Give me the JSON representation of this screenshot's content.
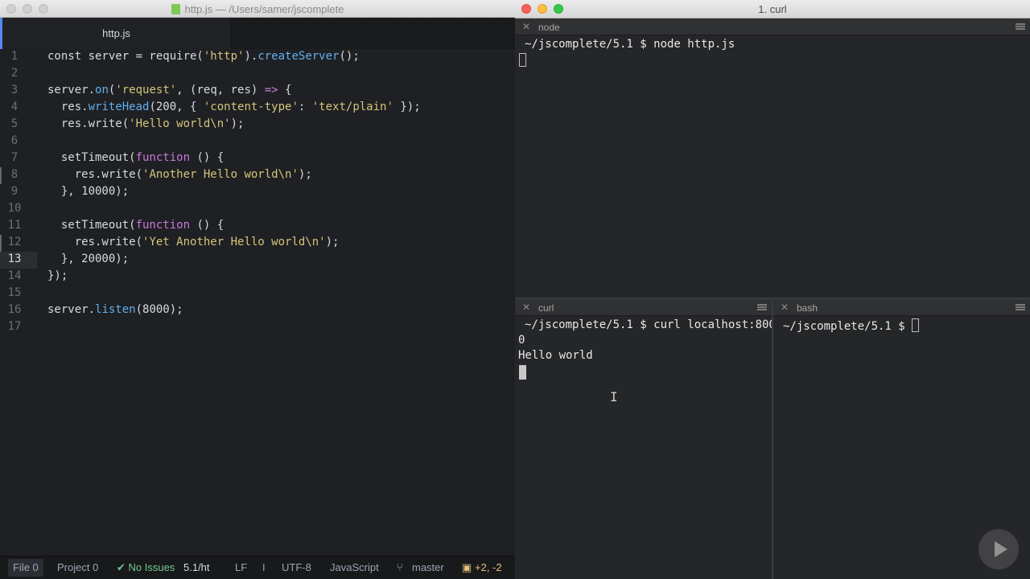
{
  "editor": {
    "window_title": "http.js — /Users/samer/jscomplete",
    "tab_label": "http.js",
    "active_line": 13,
    "lines": [
      {
        "num": "1",
        "tokens": [
          [
            "n",
            "const server = require("
          ],
          [
            "s",
            "'http'"
          ],
          [
            "n",
            ")."
          ],
          [
            "f",
            "createServer"
          ],
          [
            "n",
            "();"
          ]
        ]
      },
      {
        "num": "2",
        "tokens": []
      },
      {
        "num": "3",
        "tokens": [
          [
            "n",
            "server."
          ],
          [
            "f",
            "on"
          ],
          [
            "n",
            "("
          ],
          [
            "s",
            "'request'"
          ],
          [
            "n",
            ", (req, res) "
          ],
          [
            "k",
            "=>"
          ],
          [
            "n",
            " {"
          ]
        ]
      },
      {
        "num": "4",
        "tokens": [
          [
            "n",
            "  res."
          ],
          [
            "f",
            "writeHead"
          ],
          [
            "n",
            "(200, { "
          ],
          [
            "s",
            "'content-type'"
          ],
          [
            "n",
            ": "
          ],
          [
            "s",
            "'text/plain'"
          ],
          [
            "n",
            " });"
          ]
        ]
      },
      {
        "num": "5",
        "tokens": [
          [
            "n",
            "  res.write("
          ],
          [
            "s",
            "'Hello world\\n'"
          ],
          [
            "n",
            ");"
          ]
        ]
      },
      {
        "num": "6",
        "tokens": []
      },
      {
        "num": "7",
        "tokens": [
          [
            "n",
            "  setTimeout("
          ],
          [
            "k",
            "function"
          ],
          [
            "n",
            " () {"
          ]
        ]
      },
      {
        "num": "8",
        "tokens": [
          [
            "n",
            "    res.write("
          ],
          [
            "s",
            "'Another Hello world\\n'"
          ],
          [
            "n",
            ");"
          ]
        ]
      },
      {
        "num": "9",
        "tokens": [
          [
            "n",
            "  }, 10000);"
          ]
        ]
      },
      {
        "num": "10",
        "tokens": []
      },
      {
        "num": "11",
        "tokens": [
          [
            "n",
            "  setTimeout("
          ],
          [
            "k",
            "function"
          ],
          [
            "n",
            " () {"
          ]
        ]
      },
      {
        "num": "12",
        "tokens": [
          [
            "n",
            "    res.write("
          ],
          [
            "s",
            "'Yet Another Hello world\\n'"
          ],
          [
            "n",
            ");"
          ]
        ]
      },
      {
        "num": "13",
        "tokens": [
          [
            "n",
            "  }, 20000);"
          ]
        ]
      },
      {
        "num": "14",
        "tokens": [
          [
            "n",
            "});"
          ]
        ]
      },
      {
        "num": "15",
        "tokens": []
      },
      {
        "num": "16",
        "tokens": [
          [
            "n",
            "server."
          ],
          [
            "f",
            "listen"
          ],
          [
            "n",
            "(8000);"
          ]
        ]
      },
      {
        "num": "17",
        "tokens": []
      }
    ],
    "modified_lines": [
      8,
      12
    ],
    "status": {
      "file": "File 0",
      "project": "Project 0",
      "issues": "✔ No Issues",
      "path": "5.1/ht",
      "line_ending": "LF",
      "cursor_glyph": "I",
      "encoding": "UTF-8",
      "grammar": "JavaScript",
      "branch": "master",
      "git_diff": "+2, -2"
    }
  },
  "terminal": {
    "window_title": "1. curl",
    "panes": {
      "node": {
        "label": "node",
        "lines": [
          "~/jscomplete/5.1 $ node http.js"
        ]
      },
      "curl": {
        "label": "curl",
        "lines": [
          "~/jscomplete/5.1 $ curl localhost:800",
          "0",
          "Hello world"
        ]
      },
      "bash": {
        "label": "bash",
        "lines": [
          "~/jscomplete/5.1 $ "
        ]
      }
    }
  },
  "colors": {
    "editor_bg": "#1f2023",
    "terminal_bg": "#252628",
    "tab_accent": "#568af2",
    "keyword": "#c678dd",
    "string": "#d4c57c",
    "function": "#61afef",
    "ok_green": "#73c990"
  }
}
